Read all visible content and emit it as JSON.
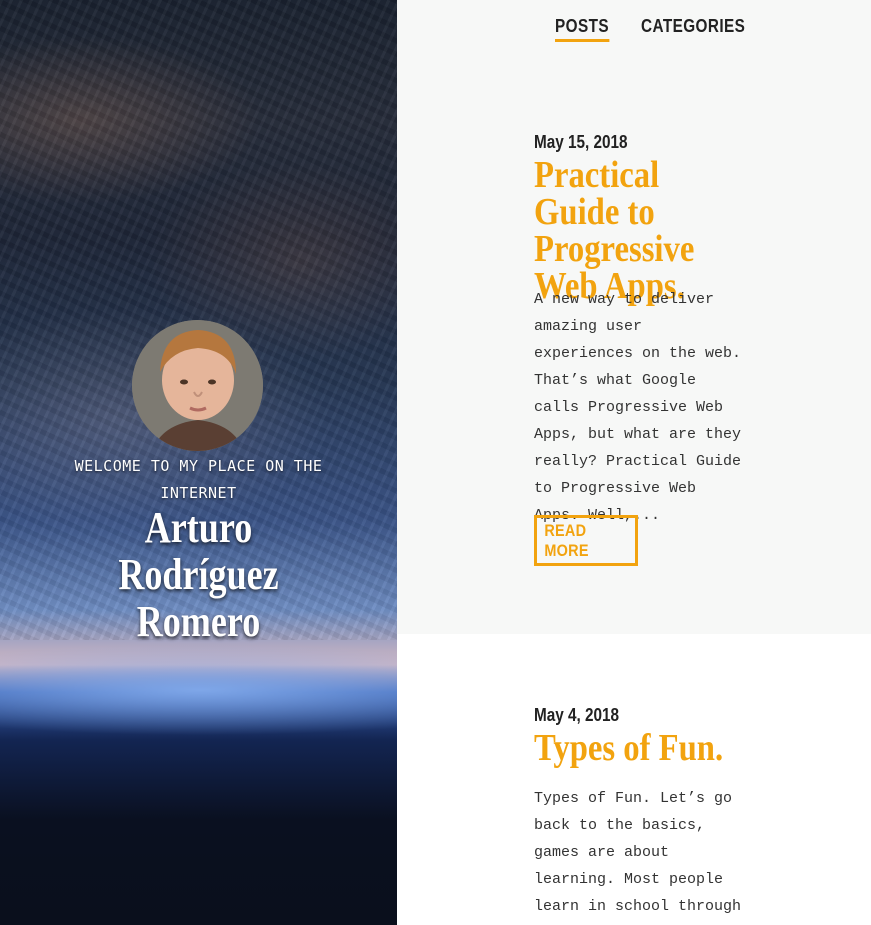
{
  "hero": {
    "welcome": "WELCOME TO MY PLACE ON THE INTERNET",
    "name": "Arturo Rodríguez Romero"
  },
  "nav": {
    "items": [
      {
        "label": "POSTS",
        "active": true
      },
      {
        "label": "CATEGORIES",
        "active": false
      }
    ]
  },
  "posts": [
    {
      "date": "May 15, 2018",
      "title": "Practical Guide to Progressive Web Apps.",
      "excerpt": "A new way to deliver amazing user experiences on the web. That’s what Google calls Progressive Web Apps, but what are they really? Practical Guide to Progressive Web Apps. Well,...",
      "read_more": "READ MORE"
    },
    {
      "date": "May 4, 2018",
      "title": "Types of Fun.",
      "excerpt": "Types of Fun. Let’s go back to the basics, games are about learning. Most people learn in school through"
    }
  ],
  "colors": {
    "accent": "#f2a30f",
    "text": "#222222",
    "card_bg": "#f7f8f7"
  }
}
